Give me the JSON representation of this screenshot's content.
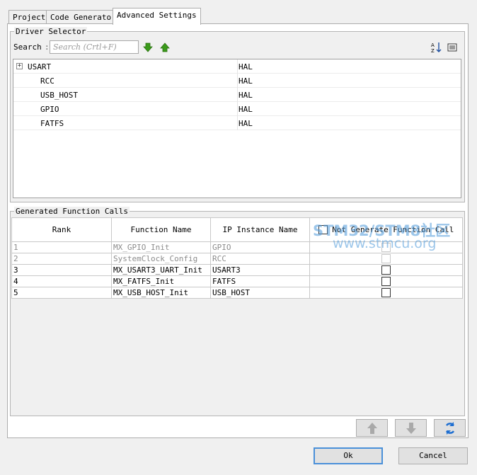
{
  "tabs": [
    {
      "label": "Project",
      "active": false
    },
    {
      "label": "Code Generator",
      "active": false
    },
    {
      "label": "Advanced Settings",
      "active": true
    }
  ],
  "driver_selector": {
    "title": "Driver Selector",
    "search_label": "Search",
    "search_placeholder": "Search (Crtl+F)",
    "rows": [
      {
        "name": "USART",
        "value": "HAL",
        "expandable": true
      },
      {
        "name": "RCC",
        "value": "HAL",
        "expandable": false
      },
      {
        "name": "USB_HOST",
        "value": "HAL",
        "expandable": false
      },
      {
        "name": "GPIO",
        "value": "HAL",
        "expandable": false
      },
      {
        "name": "FATFS",
        "value": "HAL",
        "expandable": false
      }
    ]
  },
  "function_calls": {
    "title": "Generated Function Calls",
    "columns": [
      "Rank",
      "Function Name",
      "IP Instance Name",
      "Not Generate Function Call"
    ],
    "rows": [
      {
        "rank": "1",
        "function": "MX_GPIO_Init",
        "ip": "GPIO",
        "enabled": false
      },
      {
        "rank": "2",
        "function": "SystemClock_Config",
        "ip": "RCC",
        "enabled": false
      },
      {
        "rank": "3",
        "function": "MX_USART3_UART_Init",
        "ip": "USART3",
        "enabled": true
      },
      {
        "rank": "4",
        "function": "MX_FATFS_Init",
        "ip": "FATFS",
        "enabled": true
      },
      {
        "rank": "5",
        "function": "MX_USB_HOST_Init",
        "ip": "USB_HOST",
        "enabled": true
      }
    ]
  },
  "watermark": {
    "line1": "STM32/STM8社区",
    "line2": "www.stmcu.org"
  },
  "footer": {
    "ok_label": "Ok",
    "cancel_label": "Cancel"
  },
  "colors": {
    "accent": "#4a90d9",
    "arrow_green": "#3a9a1a",
    "refresh_blue": "#1f6fd1"
  }
}
